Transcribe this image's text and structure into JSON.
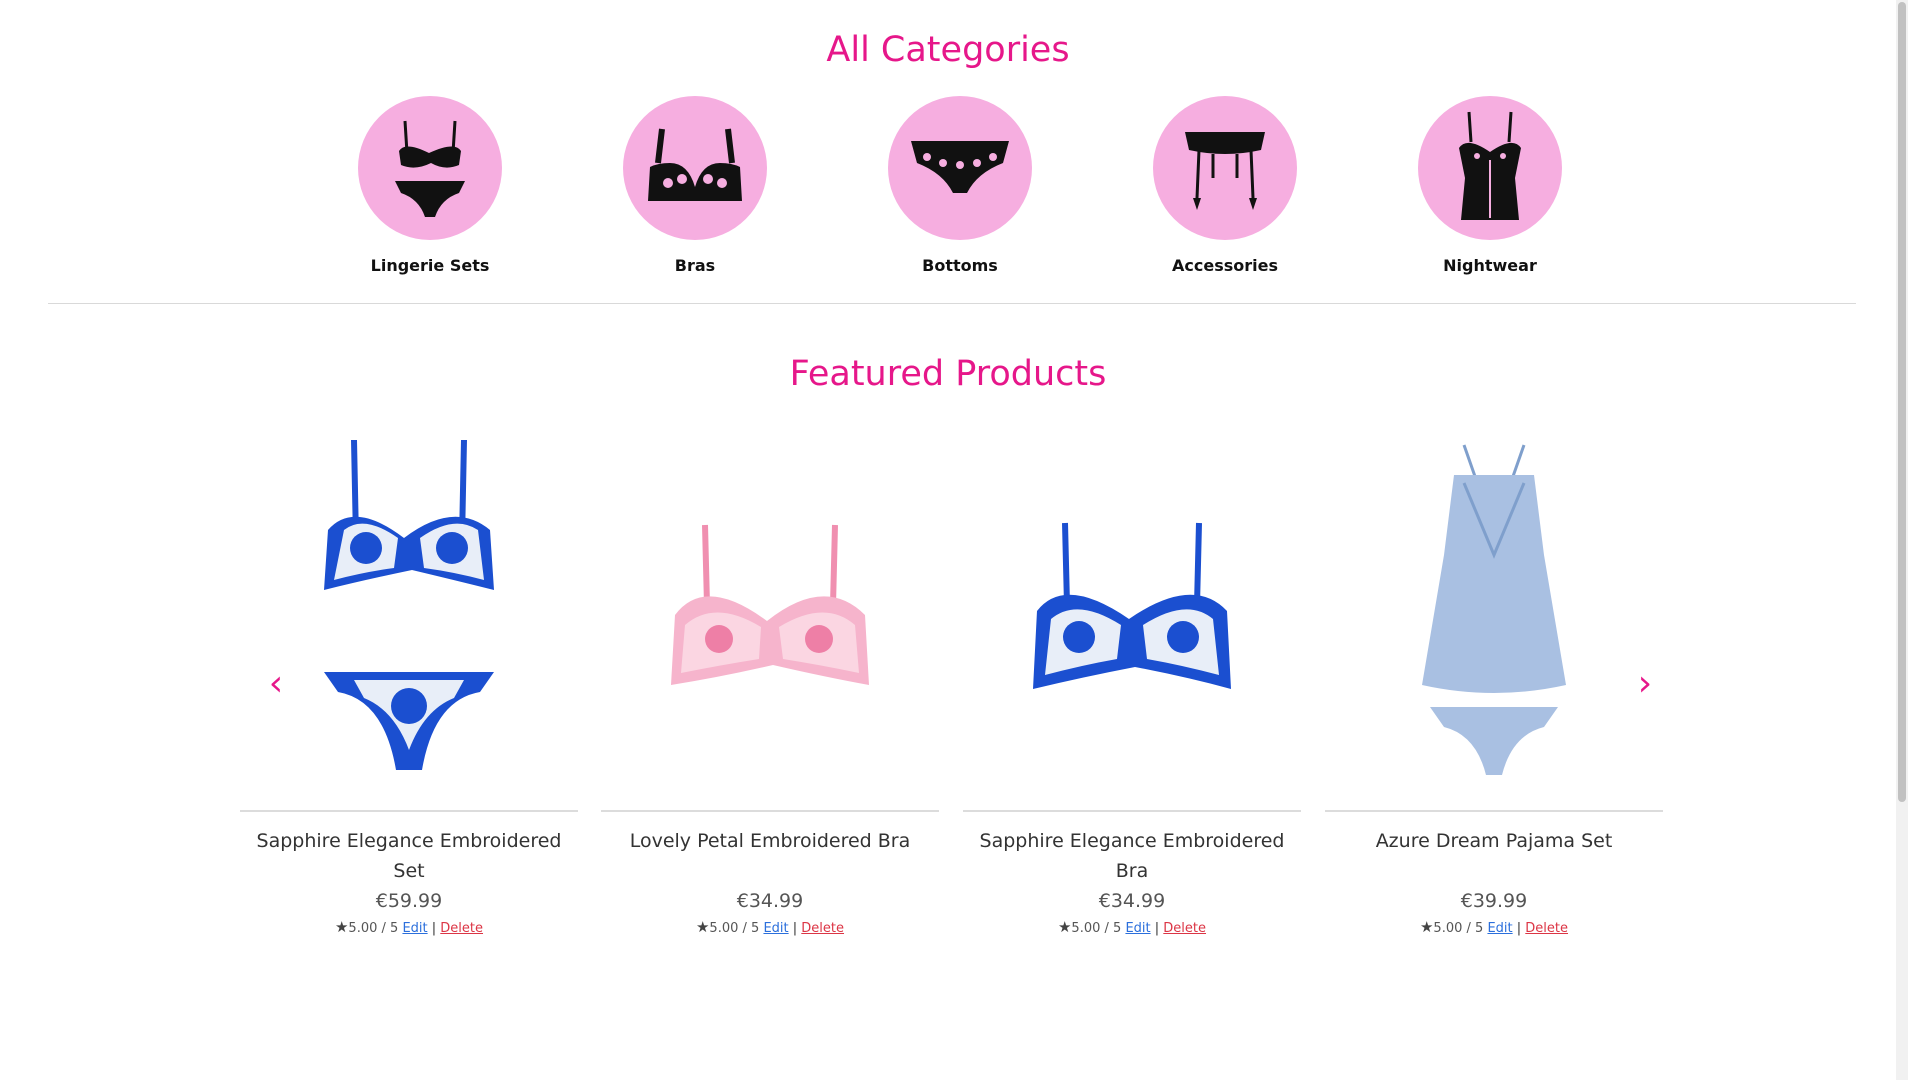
{
  "categories_section": {
    "title": "All Categories",
    "items": [
      {
        "label": "Lingerie Sets",
        "icon": "lingerie-set-icon"
      },
      {
        "label": "Bras",
        "icon": "bra-icon"
      },
      {
        "label": "Bottoms",
        "icon": "panty-icon"
      },
      {
        "label": "Accessories",
        "icon": "garter-belt-icon"
      },
      {
        "label": "Nightwear",
        "icon": "corset-icon"
      }
    ]
  },
  "featured_section": {
    "title": "Featured Products",
    "prev_label": "‹",
    "next_label": "›",
    "products": [
      {
        "name": "Sapphire Elegance Embroidered Set",
        "price": "€59.99",
        "rating": "5.00 / 5",
        "edit": "Edit",
        "delete": "Delete"
      },
      {
        "name": "Lovely Petal Embroidered Bra",
        "price": "€34.99",
        "rating": "5.00 / 5",
        "edit": "Edit",
        "delete": "Delete"
      },
      {
        "name": "Sapphire Elegance Embroidered Bra",
        "price": "€34.99",
        "rating": "5.00 / 5",
        "edit": "Edit",
        "delete": "Delete"
      },
      {
        "name": "Azure Dream Pajama Set",
        "price": "€39.99",
        "rating": "5.00 / 5",
        "edit": "Edit",
        "delete": "Delete"
      }
    ]
  },
  "colors": {
    "accent": "#e6178a",
    "category_circle": "#f6aee0",
    "edit_link": "#2b6fdc",
    "delete_link": "#dc3545"
  }
}
